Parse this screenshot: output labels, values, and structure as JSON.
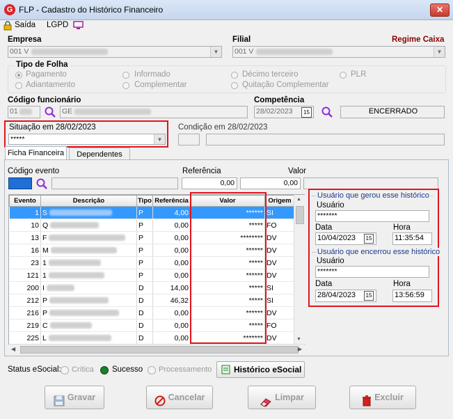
{
  "window": {
    "title": "FLP - Cadastro do Histórico Financeiro",
    "close_label": "✕"
  },
  "menu": {
    "exit_label": "Saída",
    "lgpd_label": "LGPD"
  },
  "empresa": {
    "label": "Empresa",
    "value": "001 V"
  },
  "filial": {
    "label": "Filial",
    "value": "001 V"
  },
  "regime": {
    "label": "Regime Caixa"
  },
  "tipo_folha": {
    "label": "Tipo de Folha",
    "options": [
      "Pagamento",
      "Adiantamento",
      "Informado",
      "Complementar",
      "Décimo terceiro",
      "Quitação Complementar",
      "PLR"
    ],
    "selected": "Pagamento"
  },
  "codigo_funcionario": {
    "label": "Código funcionário",
    "code": "01",
    "name": "GE"
  },
  "competencia": {
    "label": "Competência",
    "date": "28/02/2023",
    "status": "ENCERRADO"
  },
  "situacao": {
    "label": "Situação em  28/02/2023",
    "value": "*****"
  },
  "condicao": {
    "label": "Condição em 28/02/2023"
  },
  "tabs": [
    "Ficha Financeira",
    "Dependentes"
  ],
  "evento_filter": {
    "codigo_label": "Código evento",
    "referencia_label": "Referência",
    "valor_label": "Valor",
    "referencia_value": "0,00",
    "valor_value": "0,00"
  },
  "table": {
    "columns": [
      "Evento",
      "Descrição",
      "Tipo",
      "Referência",
      "Valor",
      "Origem"
    ],
    "rows": [
      {
        "evento": "1",
        "descricao": "S",
        "tipo": "P",
        "referencia": "4,00",
        "valor": "******",
        "origem": "SI"
      },
      {
        "evento": "10",
        "descricao": "Q",
        "tipo": "P",
        "referencia": "0,00",
        "valor": "*****",
        "origem": "FO"
      },
      {
        "evento": "13",
        "descricao": "F",
        "tipo": "P",
        "referencia": "0,00",
        "valor": "********",
        "origem": "DV"
      },
      {
        "evento": "16",
        "descricao": "M",
        "tipo": "P",
        "referencia": "0,00",
        "valor": "******",
        "origem": "DV"
      },
      {
        "evento": "23",
        "descricao": "1",
        "tipo": "P",
        "referencia": "0,00",
        "valor": "*****",
        "origem": "DV"
      },
      {
        "evento": "121",
        "descricao": "1",
        "tipo": "P",
        "referencia": "0,00",
        "valor": "******",
        "origem": "DV"
      },
      {
        "evento": "200",
        "descricao": "I",
        "tipo": "D",
        "referencia": "14,00",
        "valor": "*****",
        "origem": "SI"
      },
      {
        "evento": "212",
        "descricao": "P",
        "tipo": "D",
        "referencia": "46,32",
        "valor": "*****",
        "origem": "SI"
      },
      {
        "evento": "216",
        "descricao": "P",
        "tipo": "D",
        "referencia": "0,00",
        "valor": "******",
        "origem": "DV"
      },
      {
        "evento": "219",
        "descricao": "C",
        "tipo": "D",
        "referencia": "0,00",
        "valor": "*****",
        "origem": "FO"
      },
      {
        "evento": "225",
        "descricao": "L",
        "tipo": "D",
        "referencia": "0,00",
        "valor": "*******",
        "origem": "DV"
      }
    ]
  },
  "historico": {
    "gerou": {
      "title": "Usuário que gerou esse histórico",
      "usuario_label": "Usuário",
      "usuario": "*******",
      "data_label": "Data",
      "data": "10/04/2023",
      "hora_label": "Hora",
      "hora": "11:35:54"
    },
    "encerrou": {
      "title": "Usuário que encerrou esse histórico",
      "usuario_label": "Usuário",
      "usuario": "*******",
      "data_label": "Data",
      "data": "28/04/2023",
      "hora_label": "Hora",
      "hora": "13:56:59"
    }
  },
  "esocial": {
    "label": "Status eSocial:",
    "options": [
      "Crítica",
      "Sucesso",
      "Processamento"
    ],
    "selected": "Sucesso",
    "button_label": "Histórico eSocial"
  },
  "actions": {
    "save": "Gravar",
    "cancel": "Cancelar",
    "clear": "Limpar",
    "delete": "Excluir"
  },
  "colors": {
    "accent_red": "#e0141c",
    "selection_blue": "#3399ff",
    "regime_red": "#8b0000",
    "sucesso_green": "#1a7f2b"
  }
}
